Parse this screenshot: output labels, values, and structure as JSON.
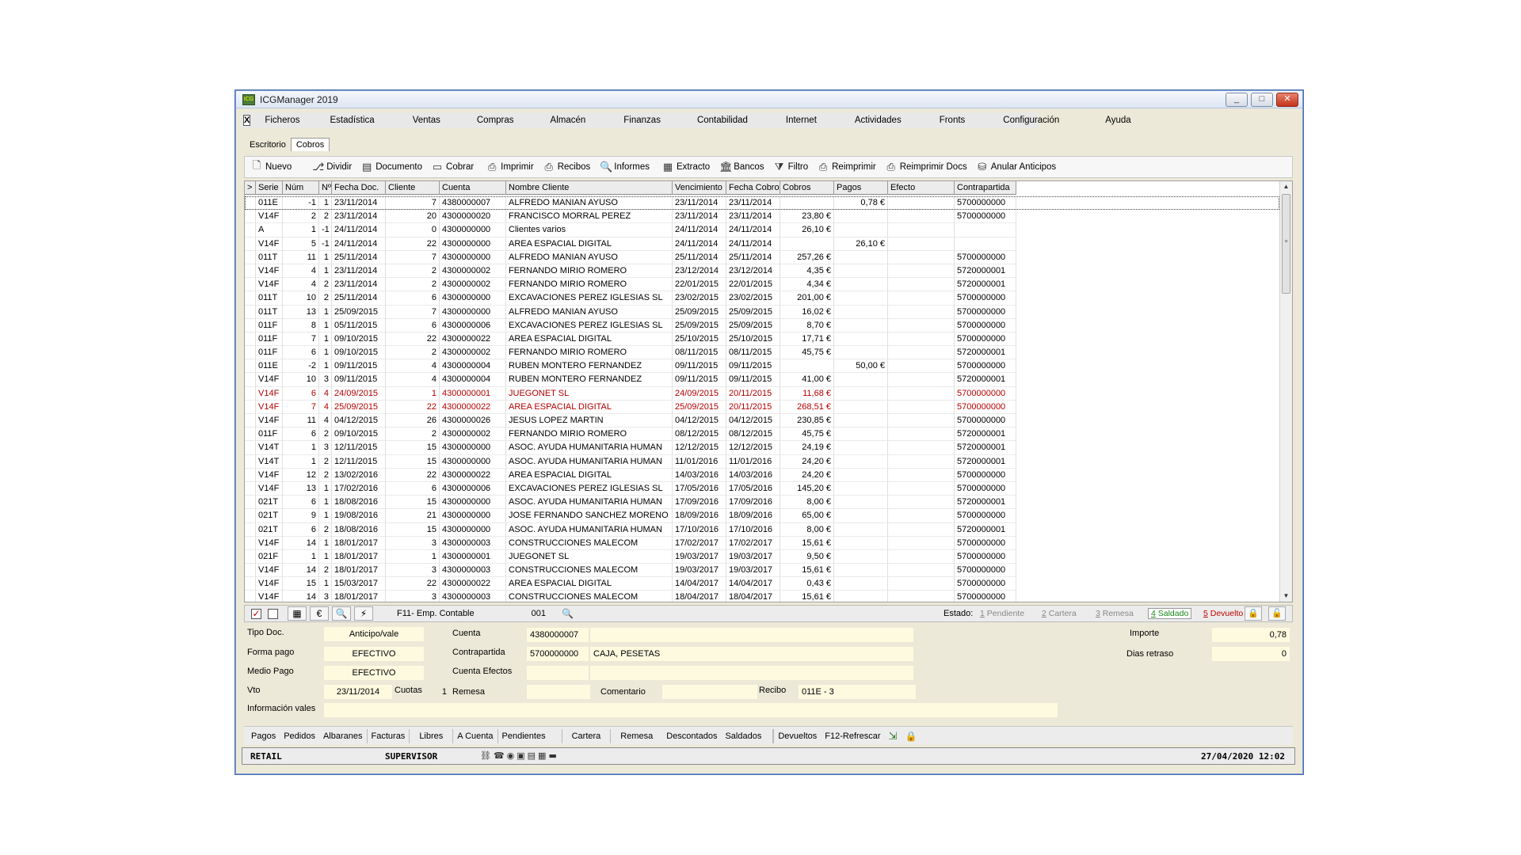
{
  "window": {
    "title": "ICGManager 2019",
    "icon_text": "ICG",
    "minimize": "_",
    "maximize": "□",
    "close": "✕"
  },
  "menu": {
    "close_mark": "X",
    "items": [
      "Ficheros",
      "Estadística",
      "Ventas",
      "Compras",
      "Almacén",
      "Finanzas",
      "Contabilidad",
      "Internet",
      "Actividades",
      "Fronts",
      "Configuración",
      "Ayuda"
    ]
  },
  "tabs": [
    "Escritorio",
    "Cobros"
  ],
  "toolbar": [
    {
      "label": "Nuevo",
      "icon": "document-icon",
      "glyph": "🗋"
    },
    {
      "label": "Dividir",
      "icon": "split-icon",
      "glyph": "⎇"
    },
    {
      "label": "Documento",
      "icon": "page-icon",
      "glyph": "▤"
    },
    {
      "label": "Cobrar",
      "icon": "cash-icon",
      "glyph": "▭"
    },
    {
      "label": "Imprimir",
      "icon": "printer-icon",
      "glyph": "⎙"
    },
    {
      "label": "Recibos",
      "icon": "receipts-icon",
      "glyph": "⎙"
    },
    {
      "label": "Informes",
      "icon": "report-icon",
      "glyph": "🔍"
    },
    {
      "label": "Extracto",
      "icon": "statement-icon",
      "glyph": "▦"
    },
    {
      "label": "Bancos",
      "icon": "bank-icon",
      "glyph": "🏛"
    },
    {
      "label": "Filtro",
      "icon": "filter-icon",
      "glyph": "⧩"
    },
    {
      "label": "Reimprimir",
      "icon": "reprint-icon",
      "glyph": "⎙"
    },
    {
      "label": "Reimprimir Docs",
      "icon": "reprint-docs-icon",
      "glyph": "⎙"
    },
    {
      "label": "Anular Anticipos",
      "icon": "cancel-advance-icon",
      "glyph": "⛁"
    }
  ],
  "grid": {
    "columns": [
      ">",
      "Serie",
      "Núm",
      "Nº",
      "Fecha Doc.",
      "Cliente",
      "Cuenta",
      "Nombre Cliente",
      "Vencimiento",
      "Fecha Cobro",
      "Cobros",
      "Pagos",
      "Efecto",
      "Contrapartida"
    ],
    "rows": [
      {
        "serie": "011E",
        "num": "-1",
        "n": "1",
        "fecha": "23/11/2014",
        "cliente": "7",
        "cuenta": "4380000007",
        "nombre": "ALFREDO MANIAN AYUSO",
        "venc": "23/11/2014",
        "fcobro": "23/11/2014",
        "cobros": "",
        "pagos": "0,78 €",
        "efecto": "",
        "contra": "5700000000",
        "red": false
      },
      {
        "serie": "V14F",
        "num": "2",
        "n": "2",
        "fecha": "23/11/2014",
        "cliente": "20",
        "cuenta": "4300000020",
        "nombre": "FRANCISCO MORRAL PEREZ",
        "venc": "23/11/2014",
        "fcobro": "23/11/2014",
        "cobros": "23,80 €",
        "pagos": "",
        "efecto": "",
        "contra": "5700000000",
        "red": false
      },
      {
        "serie": "A",
        "num": "1",
        "n": "-1",
        "fecha": "24/11/2014",
        "cliente": "0",
        "cuenta": "4300000000",
        "nombre": "Clientes varios",
        "venc": "24/11/2014",
        "fcobro": "24/11/2014",
        "cobros": "26,10 €",
        "pagos": "",
        "efecto": "",
        "contra": "",
        "red": false
      },
      {
        "serie": "V14F",
        "num": "5",
        "n": "-1",
        "fecha": "24/11/2014",
        "cliente": "22",
        "cuenta": "4300000000",
        "nombre": "AREA ESPACIAL DIGITAL",
        "venc": "24/11/2014",
        "fcobro": "24/11/2014",
        "cobros": "",
        "pagos": "26,10 €",
        "efecto": "",
        "contra": "",
        "red": false
      },
      {
        "serie": "011T",
        "num": "11",
        "n": "1",
        "fecha": "25/11/2014",
        "cliente": "7",
        "cuenta": "4300000000",
        "nombre": "ALFREDO MANIAN AYUSO",
        "venc": "25/11/2014",
        "fcobro": "25/11/2014",
        "cobros": "257,26 €",
        "pagos": "",
        "efecto": "",
        "contra": "5700000000",
        "red": false
      },
      {
        "serie": "V14F",
        "num": "4",
        "n": "1",
        "fecha": "23/11/2014",
        "cliente": "2",
        "cuenta": "4300000002",
        "nombre": "FERNANDO MIRIO ROMERO",
        "venc": "23/12/2014",
        "fcobro": "23/12/2014",
        "cobros": "4,35 €",
        "pagos": "",
        "efecto": "",
        "contra": "5720000001",
        "red": false
      },
      {
        "serie": "V14F",
        "num": "4",
        "n": "2",
        "fecha": "23/11/2014",
        "cliente": "2",
        "cuenta": "4300000002",
        "nombre": "FERNANDO MIRIO ROMERO",
        "venc": "22/01/2015",
        "fcobro": "22/01/2015",
        "cobros": "4,34 €",
        "pagos": "",
        "efecto": "",
        "contra": "5720000001",
        "red": false
      },
      {
        "serie": "011T",
        "num": "10",
        "n": "2",
        "fecha": "25/11/2014",
        "cliente": "6",
        "cuenta": "4300000000",
        "nombre": "EXCAVACIONES PEREZ IGLESIAS SL",
        "venc": "23/02/2015",
        "fcobro": "23/02/2015",
        "cobros": "201,00 €",
        "pagos": "",
        "efecto": "",
        "contra": "5700000000",
        "red": false
      },
      {
        "serie": "011T",
        "num": "13",
        "n": "1",
        "fecha": "25/09/2015",
        "cliente": "7",
        "cuenta": "4300000000",
        "nombre": "ALFREDO MANIAN AYUSO",
        "venc": "25/09/2015",
        "fcobro": "25/09/2015",
        "cobros": "16,02 €",
        "pagos": "",
        "efecto": "",
        "contra": "5700000000",
        "red": false
      },
      {
        "serie": "011F",
        "num": "8",
        "n": "1",
        "fecha": "05/11/2015",
        "cliente": "6",
        "cuenta": "4300000006",
        "nombre": "EXCAVACIONES PEREZ IGLESIAS SL",
        "venc": "25/09/2015",
        "fcobro": "25/09/2015",
        "cobros": "8,70 €",
        "pagos": "",
        "efecto": "",
        "contra": "5700000000",
        "red": false
      },
      {
        "serie": "011F",
        "num": "7",
        "n": "1",
        "fecha": "09/10/2015",
        "cliente": "22",
        "cuenta": "4300000022",
        "nombre": "AREA ESPACIAL DIGITAL",
        "venc": "25/10/2015",
        "fcobro": "25/10/2015",
        "cobros": "17,71 €",
        "pagos": "",
        "efecto": "",
        "contra": "5700000000",
        "red": false
      },
      {
        "serie": "011F",
        "num": "6",
        "n": "1",
        "fecha": "09/10/2015",
        "cliente": "2",
        "cuenta": "4300000002",
        "nombre": "FERNANDO MIRIO ROMERO",
        "venc": "08/11/2015",
        "fcobro": "08/11/2015",
        "cobros": "45,75 €",
        "pagos": "",
        "efecto": "",
        "contra": "5720000001",
        "red": false
      },
      {
        "serie": "011E",
        "num": "-2",
        "n": "1",
        "fecha": "09/11/2015",
        "cliente": "4",
        "cuenta": "4300000004",
        "nombre": "RUBEN MONTERO FERNANDEZ",
        "venc": "09/11/2015",
        "fcobro": "09/11/2015",
        "cobros": "",
        "pagos": "50,00 €",
        "efecto": "",
        "contra": "5700000000",
        "red": false
      },
      {
        "serie": "V14F",
        "num": "10",
        "n": "3",
        "fecha": "09/11/2015",
        "cliente": "4",
        "cuenta": "4300000004",
        "nombre": "RUBEN MONTERO FERNANDEZ",
        "venc": "09/11/2015",
        "fcobro": "09/11/2015",
        "cobros": "41,00 €",
        "pagos": "",
        "efecto": "",
        "contra": "5720000001",
        "red": false
      },
      {
        "serie": "V14F",
        "num": "6",
        "n": "4",
        "fecha": "24/09/2015",
        "cliente": "1",
        "cuenta": "4300000001",
        "nombre": "JUEGONET SL",
        "venc": "24/09/2015",
        "fcobro": "20/11/2015",
        "cobros": "11,68 €",
        "pagos": "",
        "efecto": "",
        "contra": "5700000000",
        "red": true
      },
      {
        "serie": "V14F",
        "num": "7",
        "n": "4",
        "fecha": "25/09/2015",
        "cliente": "22",
        "cuenta": "4300000022",
        "nombre": "AREA ESPACIAL DIGITAL",
        "venc": "25/09/2015",
        "fcobro": "20/11/2015",
        "cobros": "268,51 €",
        "pagos": "",
        "efecto": "",
        "contra": "5700000000",
        "red": true
      },
      {
        "serie": "V14F",
        "num": "11",
        "n": "4",
        "fecha": "04/12/2015",
        "cliente": "26",
        "cuenta": "4300000026",
        "nombre": "JESUS LOPEZ MARTIN",
        "venc": "04/12/2015",
        "fcobro": "04/12/2015",
        "cobros": "230,85 €",
        "pagos": "",
        "efecto": "",
        "contra": "5700000000",
        "red": false
      },
      {
        "serie": "011F",
        "num": "6",
        "n": "2",
        "fecha": "09/10/2015",
        "cliente": "2",
        "cuenta": "4300000002",
        "nombre": "FERNANDO MIRIO ROMERO",
        "venc": "08/12/2015",
        "fcobro": "08/12/2015",
        "cobros": "45,75 €",
        "pagos": "",
        "efecto": "",
        "contra": "5720000001",
        "red": false
      },
      {
        "serie": "V14T",
        "num": "1",
        "n": "3",
        "fecha": "12/11/2015",
        "cliente": "15",
        "cuenta": "4300000000",
        "nombre": "ASOC. AYUDA HUMANITARIA HUMAN",
        "venc": "12/12/2015",
        "fcobro": "12/12/2015",
        "cobros": "24,19 €",
        "pagos": "",
        "efecto": "",
        "contra": "5720000001",
        "red": false
      },
      {
        "serie": "V14T",
        "num": "1",
        "n": "2",
        "fecha": "12/11/2015",
        "cliente": "15",
        "cuenta": "4300000000",
        "nombre": "ASOC. AYUDA HUMANITARIA HUMAN",
        "venc": "11/01/2016",
        "fcobro": "11/01/2016",
        "cobros": "24,20 €",
        "pagos": "",
        "efecto": "",
        "contra": "5720000001",
        "red": false
      },
      {
        "serie": "V14F",
        "num": "12",
        "n": "2",
        "fecha": "13/02/2016",
        "cliente": "22",
        "cuenta": "4300000022",
        "nombre": "AREA ESPACIAL DIGITAL",
        "venc": "14/03/2016",
        "fcobro": "14/03/2016",
        "cobros": "24,20 €",
        "pagos": "",
        "efecto": "",
        "contra": "5700000000",
        "red": false
      },
      {
        "serie": "V14F",
        "num": "13",
        "n": "1",
        "fecha": "17/02/2016",
        "cliente": "6",
        "cuenta": "4300000006",
        "nombre": "EXCAVACIONES PEREZ IGLESIAS SL",
        "venc": "17/05/2016",
        "fcobro": "17/05/2016",
        "cobros": "145,20 €",
        "pagos": "",
        "efecto": "",
        "contra": "5700000000",
        "red": false
      },
      {
        "serie": "021T",
        "num": "6",
        "n": "1",
        "fecha": "18/08/2016",
        "cliente": "15",
        "cuenta": "4300000000",
        "nombre": "ASOC. AYUDA HUMANITARIA HUMAN",
        "venc": "17/09/2016",
        "fcobro": "17/09/2016",
        "cobros": "8,00 €",
        "pagos": "",
        "efecto": "",
        "contra": "5720000001",
        "red": false
      },
      {
        "serie": "021T",
        "num": "9",
        "n": "1",
        "fecha": "19/08/2016",
        "cliente": "21",
        "cuenta": "4300000000",
        "nombre": "JOSE FERNANDO SANCHEZ MORENO",
        "venc": "18/09/2016",
        "fcobro": "18/09/2016",
        "cobros": "65,00 €",
        "pagos": "",
        "efecto": "",
        "contra": "5700000000",
        "red": false
      },
      {
        "serie": "021T",
        "num": "6",
        "n": "2",
        "fecha": "18/08/2016",
        "cliente": "15",
        "cuenta": "4300000000",
        "nombre": "ASOC. AYUDA HUMANITARIA HUMAN",
        "venc": "17/10/2016",
        "fcobro": "17/10/2016",
        "cobros": "8,00 €",
        "pagos": "",
        "efecto": "",
        "contra": "5720000001",
        "red": false
      },
      {
        "serie": "V14F",
        "num": "14",
        "n": "1",
        "fecha": "18/01/2017",
        "cliente": "3",
        "cuenta": "4300000003",
        "nombre": "CONSTRUCCIONES MALECOM",
        "venc": "17/02/2017",
        "fcobro": "17/02/2017",
        "cobros": "15,61 €",
        "pagos": "",
        "efecto": "",
        "contra": "5700000000",
        "red": false
      },
      {
        "serie": "021F",
        "num": "1",
        "n": "1",
        "fecha": "18/01/2017",
        "cliente": "1",
        "cuenta": "4300000001",
        "nombre": "JUEGONET SL",
        "venc": "19/03/2017",
        "fcobro": "19/03/2017",
        "cobros": "9,50 €",
        "pagos": "",
        "efecto": "",
        "contra": "5700000000",
        "red": false
      },
      {
        "serie": "V14F",
        "num": "14",
        "n": "2",
        "fecha": "18/01/2017",
        "cliente": "3",
        "cuenta": "4300000003",
        "nombre": "CONSTRUCCIONES MALECOM",
        "venc": "19/03/2017",
        "fcobro": "19/03/2017",
        "cobros": "15,61 €",
        "pagos": "",
        "efecto": "",
        "contra": "5700000000",
        "red": false
      },
      {
        "serie": "V14F",
        "num": "15",
        "n": "1",
        "fecha": "15/03/2017",
        "cliente": "22",
        "cuenta": "4300000022",
        "nombre": "AREA ESPACIAL DIGITAL",
        "venc": "14/04/2017",
        "fcobro": "14/04/2017",
        "cobros": "0,43 €",
        "pagos": "",
        "efecto": "",
        "contra": "5700000000",
        "red": false
      },
      {
        "serie": "V14F",
        "num": "14",
        "n": "3",
        "fecha": "18/01/2017",
        "cliente": "3",
        "cuenta": "4300000003",
        "nombre": "CONSTRUCCIONES MALECOM",
        "venc": "18/04/2017",
        "fcobro": "18/04/2017",
        "cobros": "15,61 €",
        "pagos": "",
        "efecto": "",
        "contra": "5700000000",
        "red": false
      }
    ]
  },
  "statusbar": {
    "check_mark": "✓",
    "btn_calc": "▦",
    "btn_euro": "€",
    "btn_search": "🔍",
    "btn_flash": "⚡",
    "empresa_label": "F11- Emp. Contable",
    "empresa_value": "001",
    "estado_label": "Estado:",
    "states": [
      {
        "num": "1",
        "text": " Pendiente",
        "color": "#8a8a8a"
      },
      {
        "num": "2",
        "text": " Cartera",
        "color": "#8a8a8a"
      },
      {
        "num": "3",
        "text": " Remesa",
        "color": "#8a8a8a"
      },
      {
        "num": "4",
        "text": " Saldado",
        "color": "#1a8a1a"
      },
      {
        "num": "5",
        "text": " Devuelto",
        "color": "#c00000"
      }
    ],
    "lock1": "🔒",
    "lock2": "🔓"
  },
  "form": {
    "tipo_doc_label": "Tipo Doc.",
    "tipo_doc": "Anticipo/vale",
    "forma_pago_label": "Forma pago",
    "forma_pago": "EFECTIVO",
    "medio_pago_label": "Medio Pago",
    "medio_pago": "EFECTIVO",
    "vto_label": "Vto",
    "vto": "23/11/2014",
    "cuotas_label": "Cuotas",
    "cuotas": "1",
    "info_vales_label": "Información vales",
    "cuenta_label": "Cuenta",
    "cuenta": "4380000007",
    "contrapartida_label": "Contrapartida",
    "contrapartida": "5700000000",
    "contrapartida_name": "CAJA, PESETAS",
    "cuenta_efectos_label": "Cuenta Efectos",
    "remesa_label": "Remesa",
    "comentario_label": "Comentario",
    "recibo_label": "Recibo",
    "recibo": "011E - 3",
    "importe_label": "Importe",
    "importe": "0,78",
    "dias_retraso_label": "Dias retraso",
    "dias_retraso": "0"
  },
  "bottom_tabs": [
    "Pagos",
    "Pedidos",
    "Albaranes",
    "Facturas",
    "Libres",
    "A Cuenta",
    "Pendientes",
    "Cartera",
    "Remesa",
    "Descontados",
    "Saldados",
    "Devueltos",
    "F12-Refrescar"
  ],
  "bottom_icons": {
    "export": "⇲",
    "lock": "🔒"
  },
  "footer": {
    "retail": "RETAIL",
    "user": "SUPERVISOR",
    "icons": "⛓☎◉▣▤▦▬",
    "datetime": "27/04/2020 12:02"
  }
}
